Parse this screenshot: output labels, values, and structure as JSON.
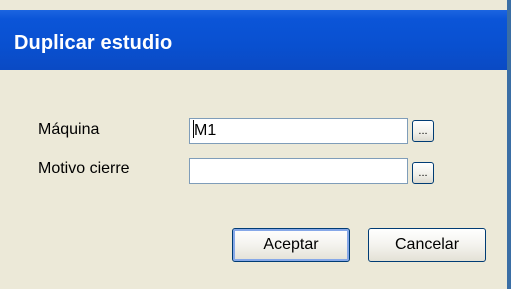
{
  "dialog": {
    "title": "Duplicar estudio"
  },
  "form": {
    "machine_label": "Máquina",
    "machine_value": "M1",
    "machine_browse_label": "...",
    "reason_label": "Motivo cierre",
    "reason_value": "",
    "reason_browse_label": "..."
  },
  "buttons": {
    "accept_label": "Aceptar",
    "cancel_label": "Cancelar"
  },
  "colors": {
    "titlebar": "#0a50d0",
    "dialog_background": "#ece9d8",
    "button_border": "#003c74"
  }
}
